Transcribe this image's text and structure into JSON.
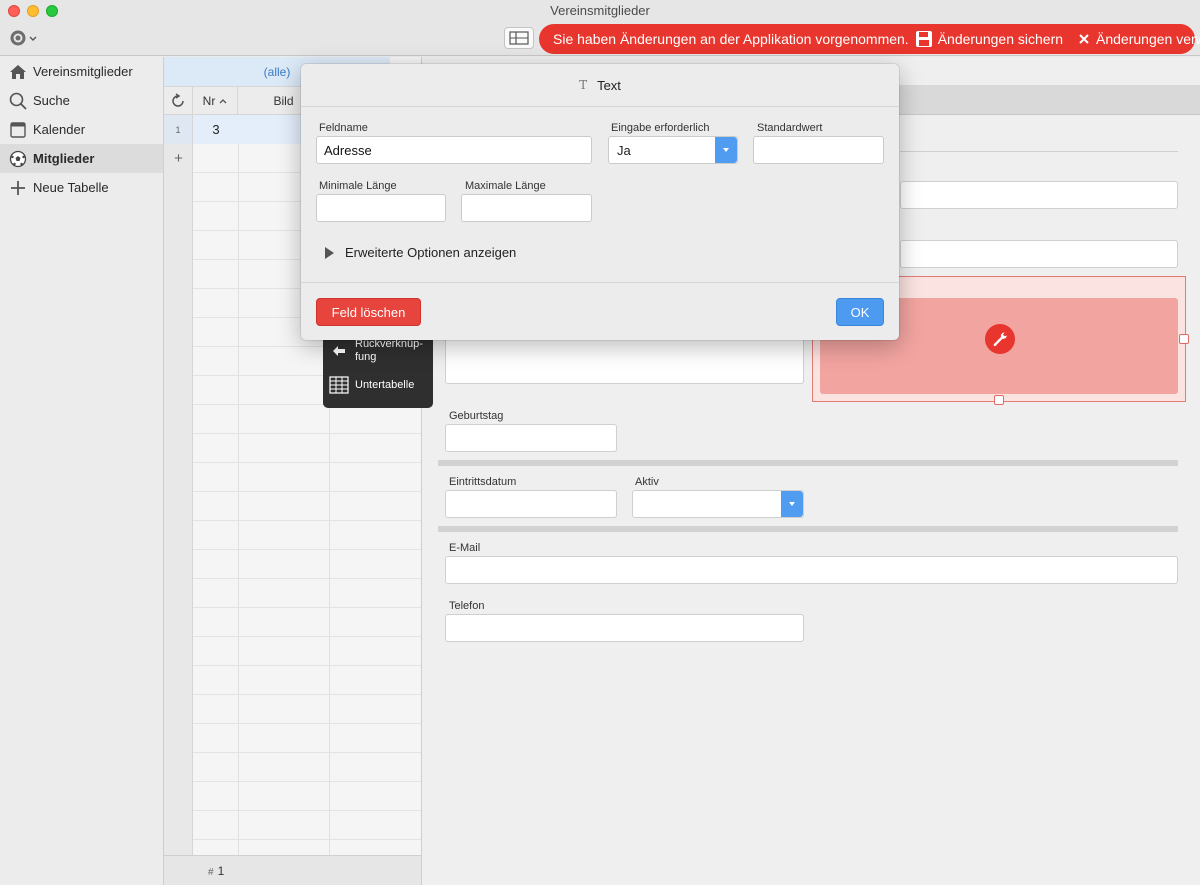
{
  "window": {
    "title": "Vereinsmitglieder"
  },
  "notice": {
    "text": "Sie haben Änderungen an der Applikation vorgenommen.",
    "save_label": "Änderungen sichern",
    "discard_label": "Änderungen verwerfen",
    "color": "#e8352d"
  },
  "sidebar": {
    "items": [
      {
        "label": "Vereinsmitglieder",
        "icon": "home-icon"
      },
      {
        "label": "Suche",
        "icon": "search-icon"
      },
      {
        "label": "Kalender",
        "icon": "calendar-icon"
      },
      {
        "label": "Mitglieder",
        "icon": "soccer-ball-icon",
        "active": true
      },
      {
        "label": "Neue Tabelle",
        "icon": "plus-icon"
      }
    ]
  },
  "grid": {
    "filter": "(alle)",
    "columns": [
      "Nr",
      "Bild"
    ],
    "rows": [
      {
        "index": "1",
        "nr": "3"
      }
    ],
    "footer_count": "1",
    "footer_hash": "#"
  },
  "field_menu": {
    "items": [
      {
        "label": "Rückverknüp-fung",
        "icon": "arrow-left-icon"
      },
      {
        "label": "Untertabelle",
        "icon": "table-grid-icon"
      }
    ]
  },
  "form": {
    "labels": {
      "geburtstag": "Geburtstag",
      "eintrittsdatum": "Eintrittsdatum",
      "aktiv": "Aktiv",
      "email": "E-Mail",
      "telefon": "Telefon"
    }
  },
  "dialog": {
    "title": "Text",
    "title_icon": "T",
    "feldname_label": "Feldname",
    "feldname_value": "Adresse",
    "eingabe_label": "Eingabe erforderlich",
    "eingabe_value": "Ja",
    "standardwert_label": "Standardwert",
    "standardwert_value": "",
    "min_label": "Minimale Länge",
    "min_value": "",
    "max_label": "Maximale Länge",
    "max_value": "",
    "advanced_label": "Erweiterte Optionen anzeigen",
    "delete_label": "Feld löschen",
    "ok_label": "OK"
  }
}
